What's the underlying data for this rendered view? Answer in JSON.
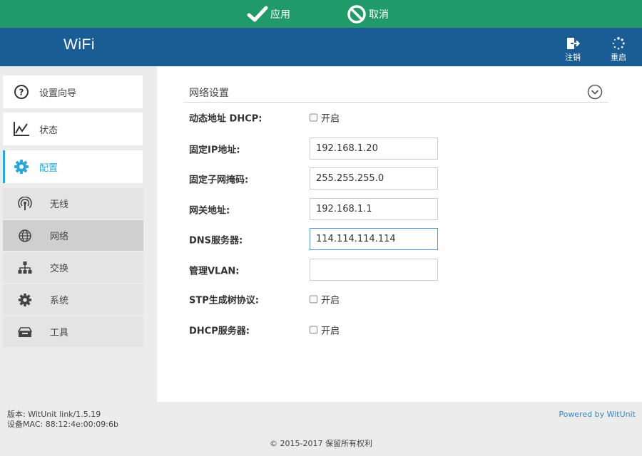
{
  "actionbar": {
    "apply_label": "应用",
    "cancel_label": "取消"
  },
  "header": {
    "brand": "WiFi",
    "logout_label": "注销",
    "reboot_label": "重启"
  },
  "sidebar": {
    "items": [
      {
        "label": "设置向导",
        "icon": "help-circle-icon"
      },
      {
        "label": "状态",
        "icon": "line-chart-icon"
      },
      {
        "label": "配置",
        "icon": "gear-icon",
        "active": true
      }
    ],
    "subitems": [
      {
        "label": "无线",
        "icon": "wireless-icon"
      },
      {
        "label": "网络",
        "icon": "globe-icon",
        "active": true
      },
      {
        "label": "交换",
        "icon": "network-tree-icon"
      },
      {
        "label": "系统",
        "icon": "gear-icon"
      },
      {
        "label": "工具",
        "icon": "toolbox-icon"
      }
    ]
  },
  "main": {
    "section_title": "网络设置",
    "fields": {
      "dhcp": {
        "label": "动态地址 DHCP:",
        "checkbox_label": "开启",
        "checked": false
      },
      "ip": {
        "label": "固定IP地址:",
        "value": "192.168.1.20"
      },
      "mask": {
        "label": "固定子网掩码:",
        "value": "255.255.255.0"
      },
      "gateway": {
        "label": "网关地址:",
        "value": "192.168.1.1"
      },
      "dns": {
        "label": "DNS服务器:",
        "value": "114.114.114.114"
      },
      "vlan": {
        "label": "管理VLAN:",
        "value": ""
      },
      "stp": {
        "label": "STP生成树协议:",
        "checkbox_label": "开启",
        "checked": false
      },
      "dhcp_server": {
        "label": "DHCP服务器:",
        "checkbox_label": "开启",
        "checked": false
      }
    }
  },
  "footer": {
    "version": "版本: WitUnit link/1.5.19",
    "mac": "设备MAC: 88:12:4e:00:09:6b",
    "powered": "Powered by WitUnit",
    "copyright": "© 2015-2017 保留所有权利"
  },
  "colors": {
    "actionbar": "#1f9a68",
    "header": "#1a5d95",
    "accent": "#29a7d8",
    "link": "#3a86c8"
  }
}
